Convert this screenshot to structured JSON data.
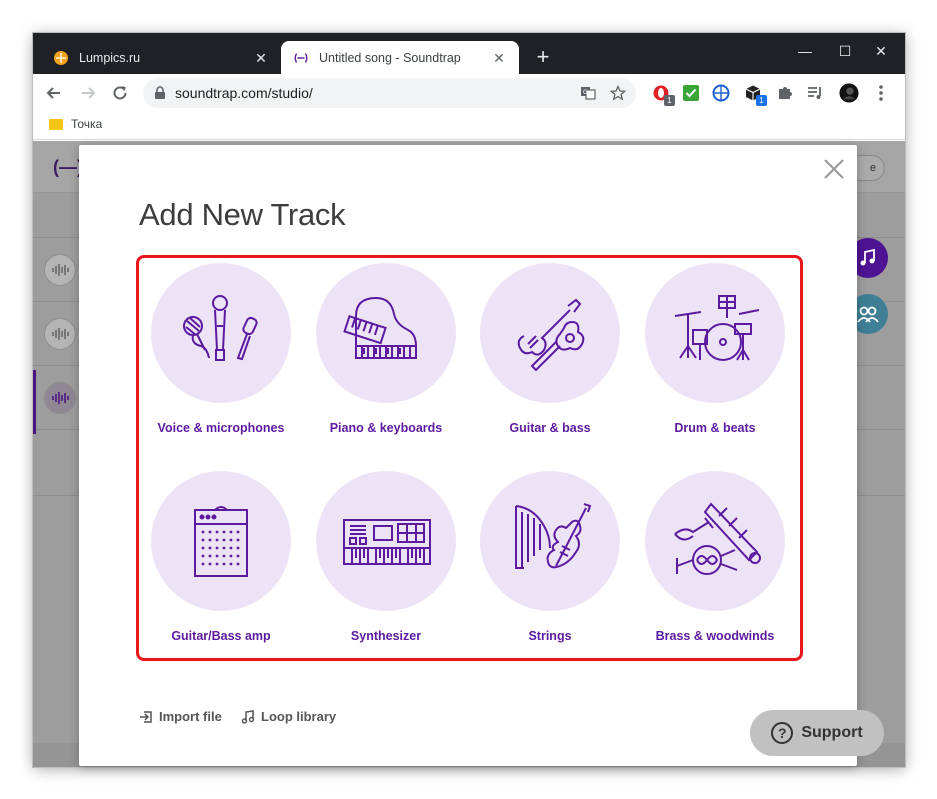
{
  "browser": {
    "tabs": [
      {
        "title": "Lumpics.ru",
        "active": false,
        "favicon": "orange-circle-icon"
      },
      {
        "title": "Untitled song - Soundtrap",
        "active": true,
        "favicon": "soundtrap-icon"
      }
    ],
    "new_tab": "+",
    "window_controls": {
      "minimize": "—",
      "maximize": "☐",
      "close": "✕"
    },
    "url": "soundtrap.com/studio/",
    "extension_badges": [
      "1",
      "1"
    ],
    "bookmarks": [
      {
        "label": "Точка"
      }
    ]
  },
  "app": {
    "logo": "(—)",
    "pill_label": "e"
  },
  "modal": {
    "title": "Add New Track",
    "close": "×",
    "categories": [
      {
        "label": "Voice & microphones",
        "icon": "microphones-icon"
      },
      {
        "label": "Piano & keyboards",
        "icon": "piano-icon"
      },
      {
        "label": "Guitar & bass",
        "icon": "guitar-icon"
      },
      {
        "label": "Drum & beats",
        "icon": "drums-icon"
      },
      {
        "label": "Guitar/Bass amp",
        "icon": "amp-icon"
      },
      {
        "label": "Synthesizer",
        "icon": "synthesizer-icon"
      },
      {
        "label": "Strings",
        "icon": "strings-icon"
      },
      {
        "label": "Brass & woodwinds",
        "icon": "brass-icon"
      }
    ],
    "import_file": "Import file",
    "loop_library": "Loop library",
    "support": "Support"
  },
  "colors": {
    "accent": "#5b1aa0",
    "circle": "#ede3f6",
    "highlight": "#e8151c"
  }
}
